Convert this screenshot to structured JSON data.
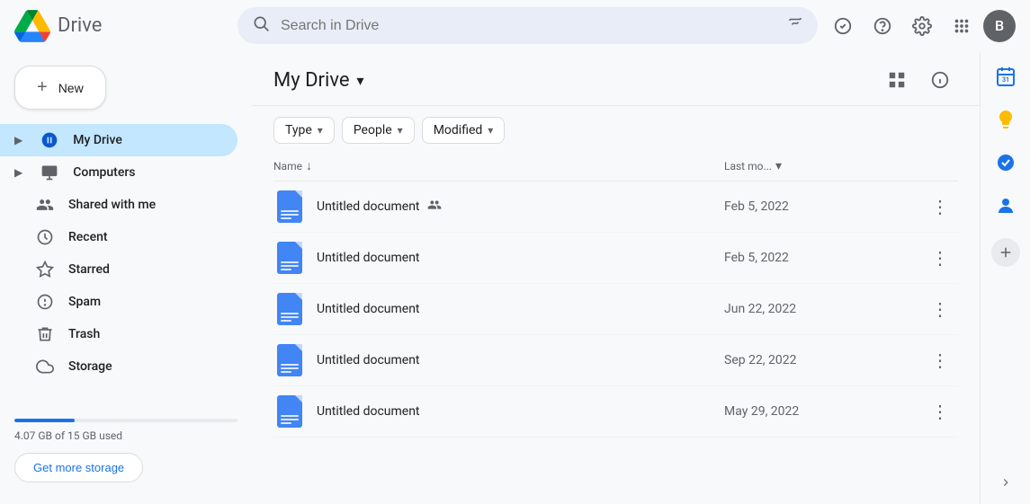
{
  "header": {
    "logo_text": "Drive",
    "search_placeholder": "Search in Drive",
    "avatar_letter": "B"
  },
  "sidebar": {
    "new_button": "New",
    "nav_items": [
      {
        "id": "my-drive",
        "label": "My Drive",
        "icon": "drive",
        "active": true,
        "expandable": true
      },
      {
        "id": "computers",
        "label": "Computers",
        "icon": "computer",
        "active": false,
        "expandable": true
      },
      {
        "id": "shared-with-me",
        "label": "Shared with me",
        "icon": "people",
        "active": false
      },
      {
        "id": "recent",
        "label": "Recent",
        "icon": "clock",
        "active": false
      },
      {
        "id": "starred",
        "label": "Starred",
        "icon": "star",
        "active": false
      },
      {
        "id": "spam",
        "label": "Spam",
        "icon": "spam",
        "active": false
      },
      {
        "id": "trash",
        "label": "Trash",
        "icon": "trash",
        "active": false
      },
      {
        "id": "storage",
        "label": "Storage",
        "icon": "cloud",
        "active": false
      }
    ],
    "storage": {
      "used_text": "4.07 GB of 15 GB used",
      "used_percent": 27,
      "get_more_label": "Get more storage"
    }
  },
  "drive": {
    "title": "My Drive",
    "filters": [
      {
        "id": "type",
        "label": "Type"
      },
      {
        "id": "people",
        "label": "People"
      },
      {
        "id": "modified",
        "label": "Modified"
      }
    ],
    "table": {
      "col_name": "Name",
      "col_date": "Last mo...",
      "files": [
        {
          "name": "Untitled document",
          "date": "Feb 5, 2022",
          "shared": true
        },
        {
          "name": "Untitled document",
          "date": "Feb 5, 2022",
          "shared": false
        },
        {
          "name": "Untitled document",
          "date": "Jun 22, 2022",
          "shared": false
        },
        {
          "name": "Untitled document",
          "date": "Sep 22, 2022",
          "shared": false
        },
        {
          "name": "Untitled document",
          "date": "May 29, 2022",
          "shared": false
        }
      ]
    }
  },
  "right_panel": {
    "icons": [
      {
        "id": "calendar",
        "symbol": "📅",
        "color": "#1a73e8"
      },
      {
        "id": "keep",
        "symbol": "📝",
        "color": "#fbbc04"
      },
      {
        "id": "tasks",
        "symbol": "✔",
        "color": "#1a73e8"
      },
      {
        "id": "contacts",
        "symbol": "👤",
        "color": "#1a73e8"
      }
    ]
  }
}
